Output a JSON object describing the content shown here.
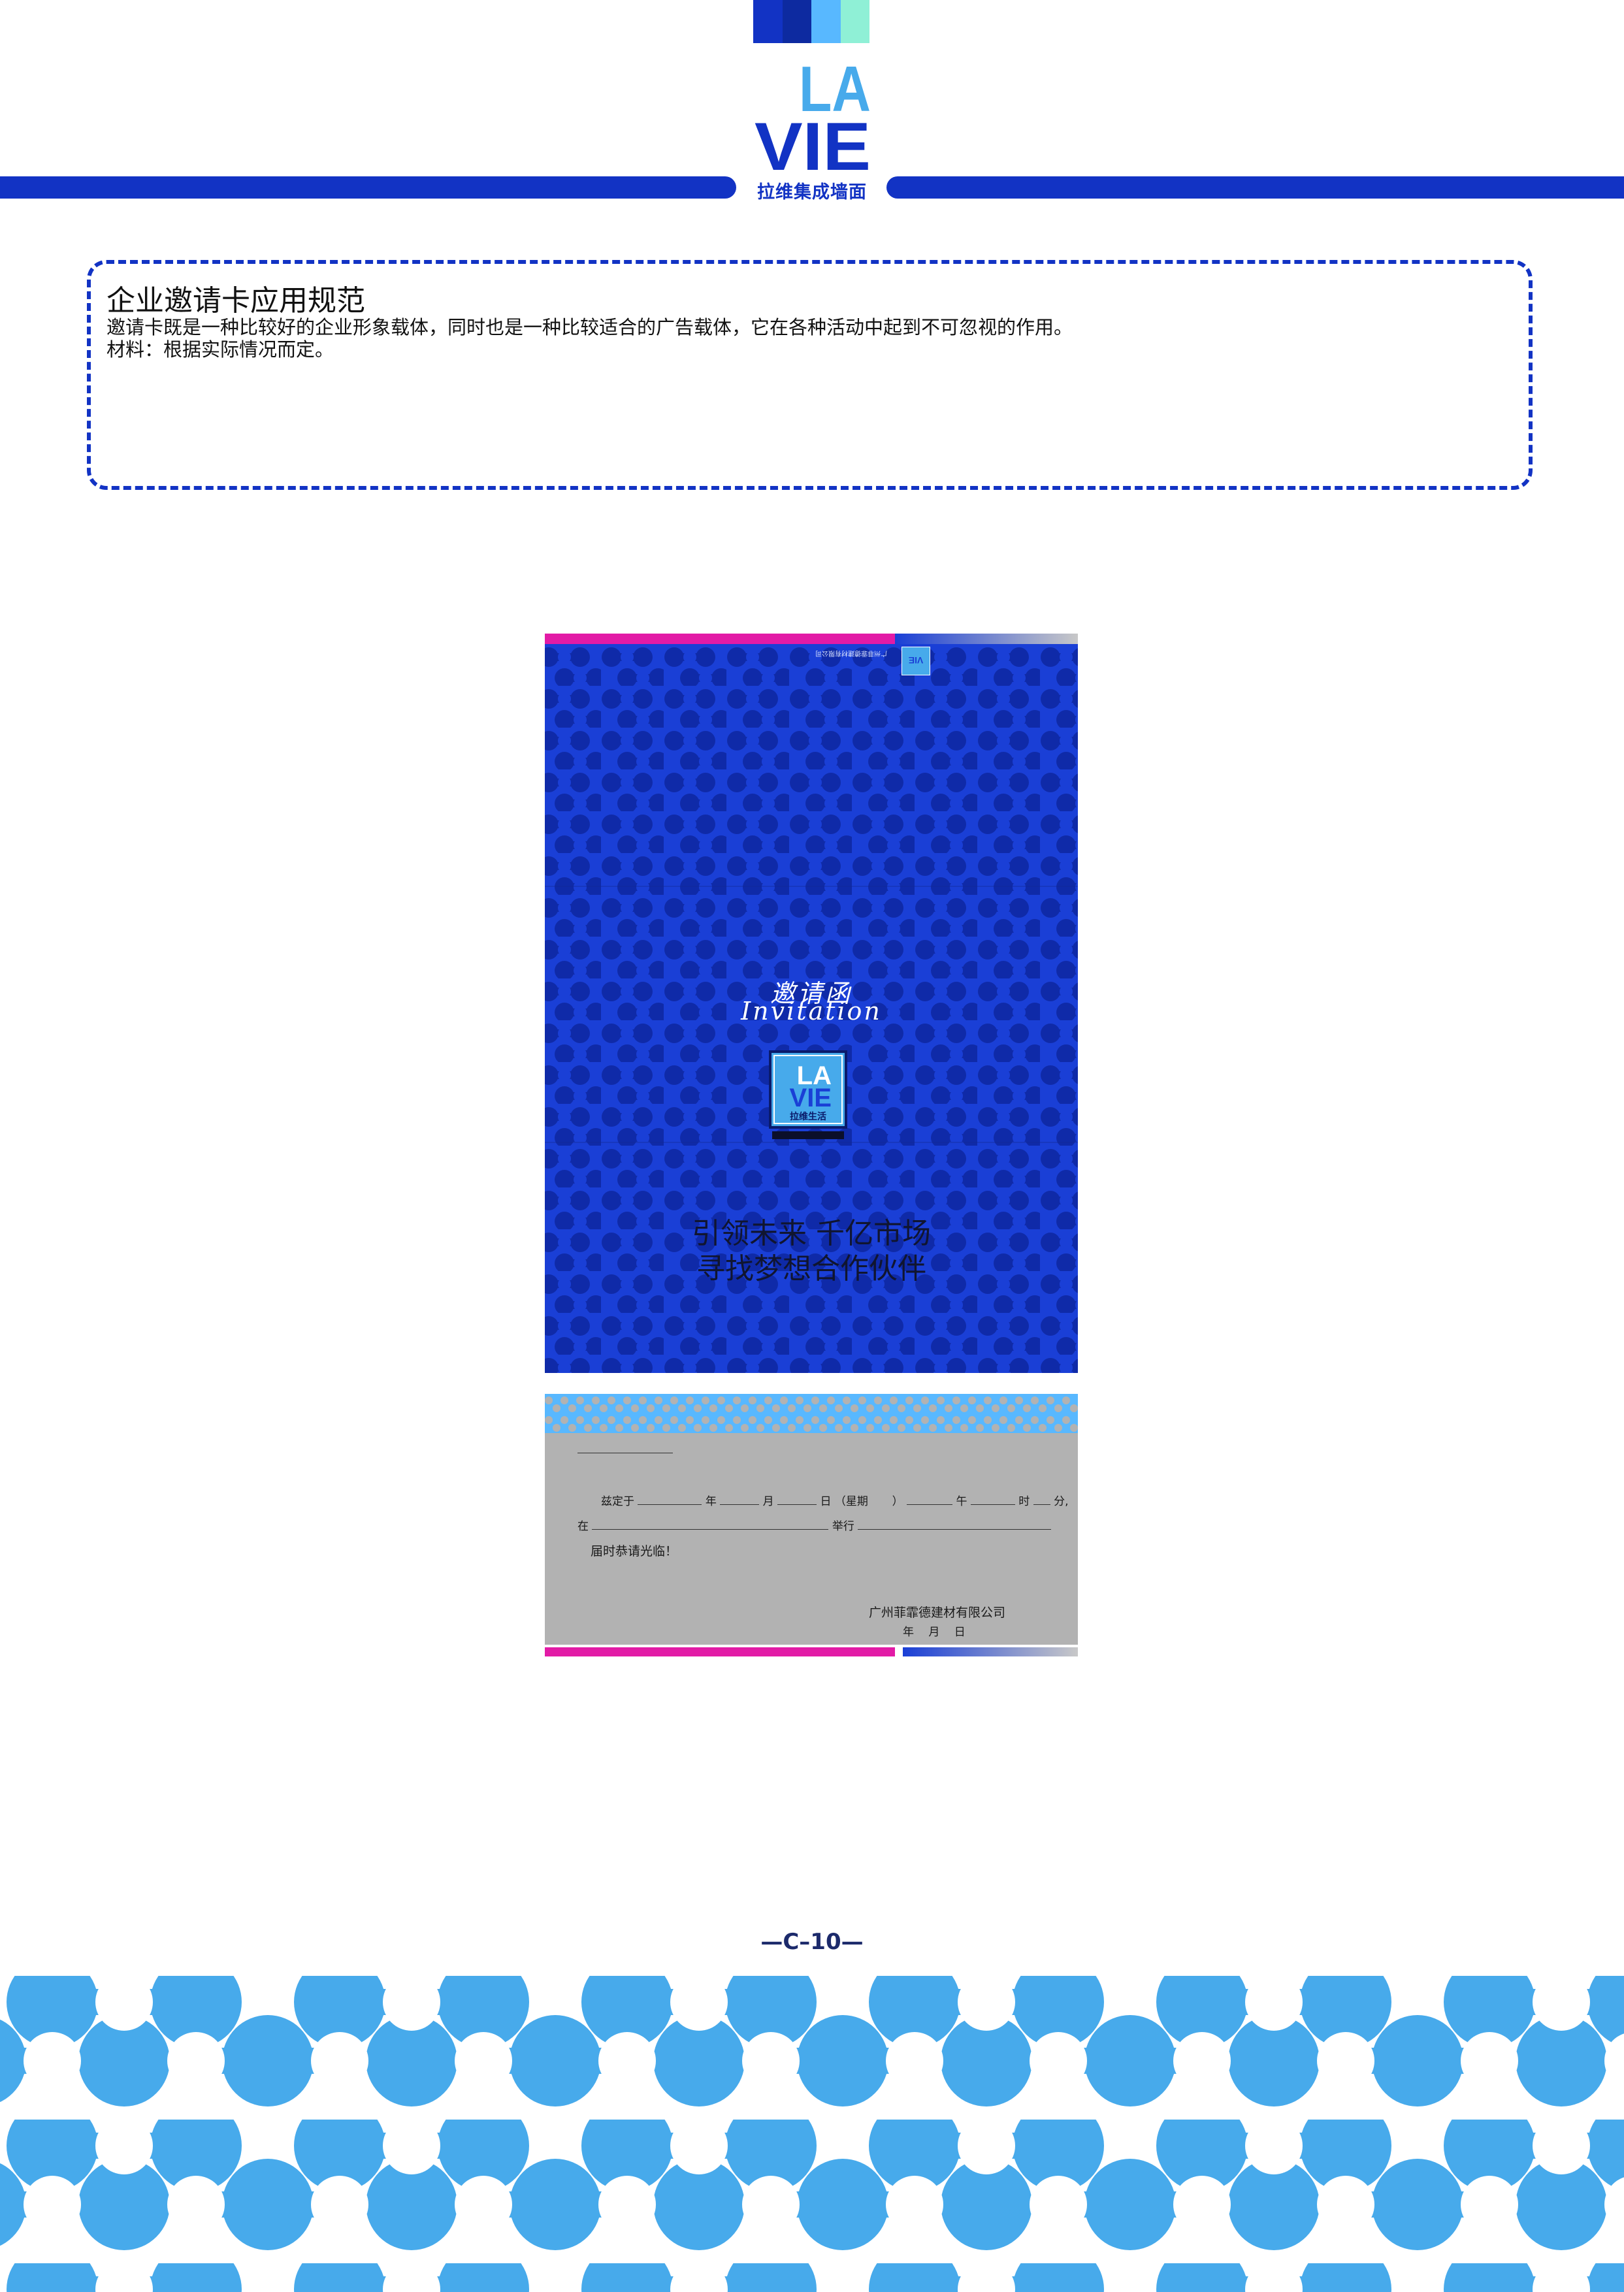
{
  "colors": {
    "brand_blue": "#1233c4",
    "card_blue": "#1a3fd6",
    "card_blue_dark": "#0f2aa8",
    "light_blue": "#47aaeb",
    "sky": "#58b8ff",
    "mint": "#8ff0d6",
    "magenta": "#e21ba6",
    "gray": "#b2b2b2"
  },
  "header": {
    "logo_line1": "LA",
    "logo_line2": "VIE",
    "logo_subtitle": "拉维集成墙面"
  },
  "spec": {
    "title": "企业邀请卡应用规范",
    "line1": "邀请卡既是一种比较好的企业形象载体，同时也是一种比较适合的广告载体，它在各种活动中起到不可忽视的作用。",
    "line2": "材料：根据实际情况而定。"
  },
  "card": {
    "title_cn": "邀请函",
    "title_en": "Invitation",
    "logo_line1": "LA",
    "logo_line2": "VIE",
    "logo_subtitle": "拉维生活",
    "slogan_line1": "引领未来 千亿市场",
    "slogan_line2": "寻找梦想合作伙伴",
    "form": {
      "intro": "兹定于",
      "year": "年",
      "month": "月",
      "day": "日",
      "weekday": "（星期",
      "weekday_close": "）",
      "noon": "午",
      "hour": "时",
      "minute": "分,",
      "at": "在",
      "held": "举行",
      "closing": "届时恭请光临！",
      "company": "广州菲霏德建材有限公司",
      "date_line": "年　 月　 日"
    }
  },
  "footer": {
    "page_number": "—C–10—"
  }
}
